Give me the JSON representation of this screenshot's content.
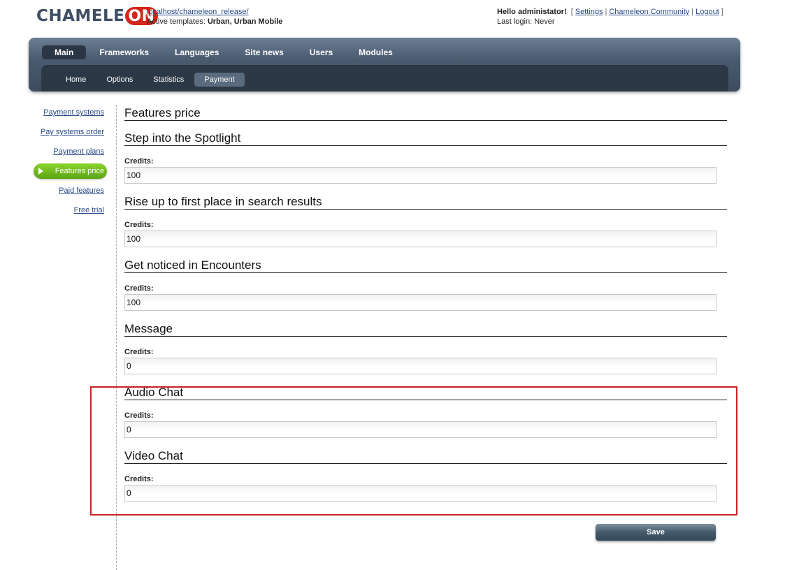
{
  "header": {
    "logo_text": "CHAMELE",
    "logo_on": "ON",
    "site_url": "localhost/chameleon_release/",
    "templates_label": "Active templates:",
    "templates_value": "Urban, Urban Mobile",
    "greeting": "Hello administator!",
    "bracket_open": "[",
    "bracket_close": "]",
    "separator": "|",
    "settings_link": "Settings",
    "community_link": "Chameleon Community",
    "logout_link": "Logout",
    "last_login": "Last login: Never"
  },
  "nav": {
    "main_tabs": [
      "Main",
      "Frameworks",
      "Languages",
      "Site news",
      "Users",
      "Modules"
    ],
    "sub_tabs": [
      "Home",
      "Options",
      "Statistics",
      "Payment"
    ]
  },
  "sidebar": {
    "items": [
      "Payment systems",
      "Pay systems order",
      "Payment plans",
      "Features price",
      "Paid features",
      "Free trial"
    ]
  },
  "content": {
    "page_title": "Features price",
    "sections": [
      {
        "title": "Step into the Spotlight",
        "label": "Credits:",
        "value": "100"
      },
      {
        "title": "Rise up to first place in search results",
        "label": "Credits:",
        "value": "100"
      },
      {
        "title": "Get noticed in Encounters",
        "label": "Credits:",
        "value": "100"
      },
      {
        "title": "Message",
        "label": "Credits:",
        "value": "0"
      },
      {
        "title": "Audio Chat",
        "label": "Credits:",
        "value": "0"
      },
      {
        "title": "Video Chat",
        "label": "Credits:",
        "value": "0"
      }
    ],
    "save_label": "Save"
  },
  "colors": {
    "brand_blue": "#3e4f63",
    "brand_red": "#d3261c",
    "active_green": "#6cba1e",
    "highlight_red": "#cc2222"
  }
}
